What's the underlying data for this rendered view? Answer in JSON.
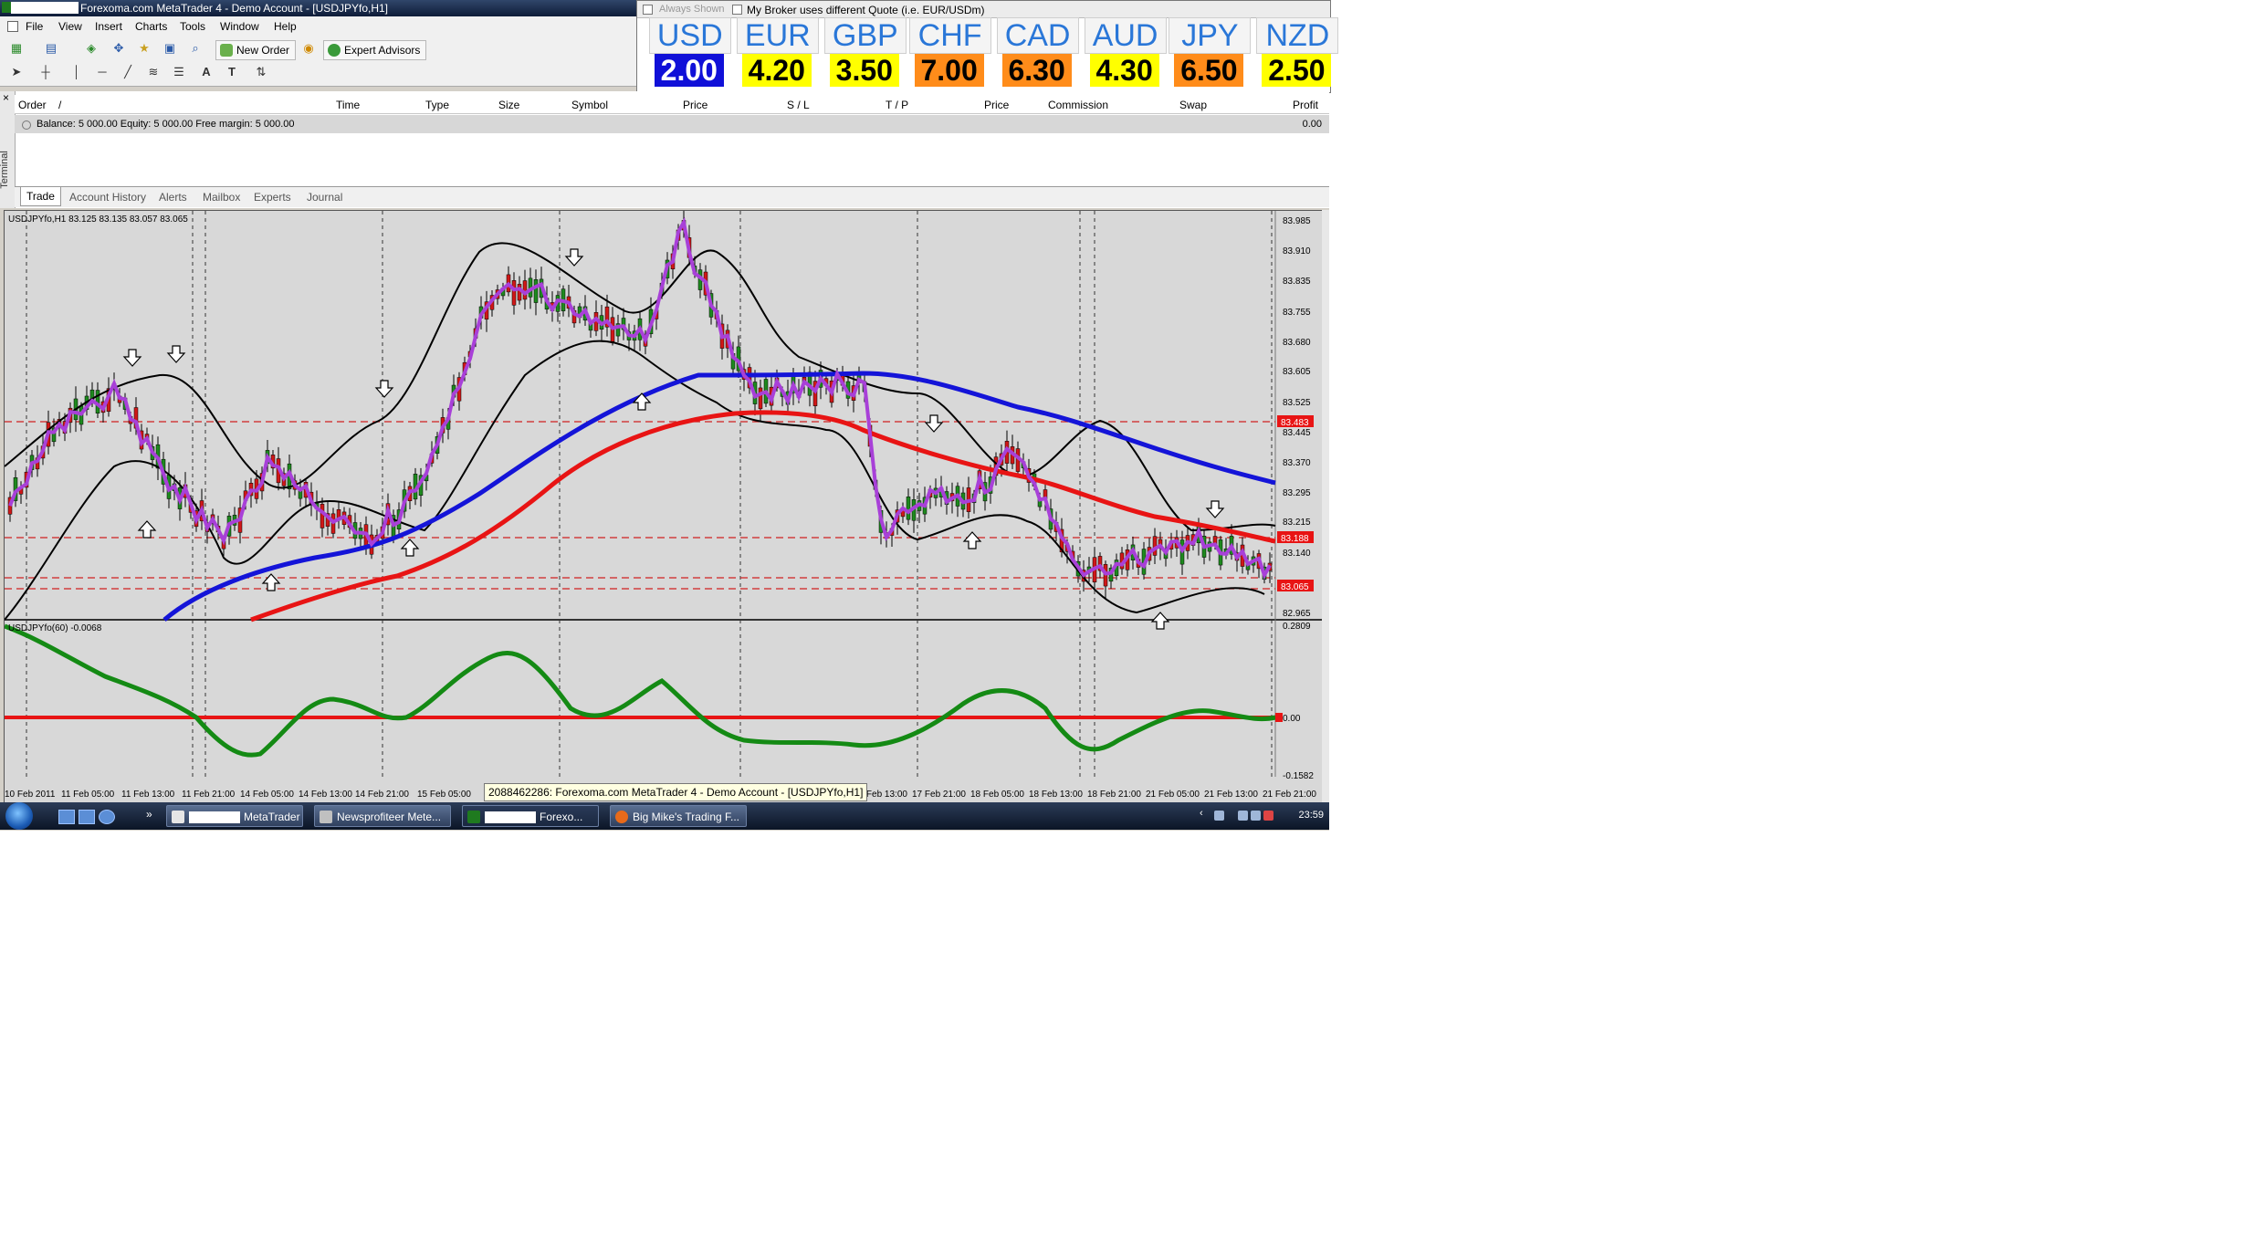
{
  "window": {
    "title": "Forexoma.com MetaTrader 4 - Demo Account - [USDJPYfo,H1]"
  },
  "menu": [
    "File",
    "View",
    "Insert",
    "Charts",
    "Tools",
    "Window",
    "Help"
  ],
  "toolbar": {
    "new_order": "New Order",
    "expert_advisors": "Expert Advisors"
  },
  "currency_widget": {
    "always_shown": "Always Shown",
    "broker_quote": "My Broker uses different Quote (i.e. EUR/USDm)",
    "items": [
      {
        "code": "USD",
        "value": "2.00",
        "bg": "#1010d8",
        "fg": "#ffffff"
      },
      {
        "code": "EUR",
        "value": "4.20",
        "bg": "#ffff00",
        "fg": "#000000"
      },
      {
        "code": "GBP",
        "value": "3.50",
        "bg": "#ffff00",
        "fg": "#000000"
      },
      {
        "code": "CHF",
        "value": "7.00",
        "bg": "#ff8c1a",
        "fg": "#000000"
      },
      {
        "code": "CAD",
        "value": "6.30",
        "bg": "#ff8c1a",
        "fg": "#000000"
      },
      {
        "code": "AUD",
        "value": "4.30",
        "bg": "#ffff00",
        "fg": "#000000"
      },
      {
        "code": "JPY",
        "value": "6.50",
        "bg": "#ff8c1a",
        "fg": "#000000"
      },
      {
        "code": "NZD",
        "value": "2.50",
        "bg": "#ffff00",
        "fg": "#000000"
      }
    ]
  },
  "terminal": {
    "side_label": "Terminal",
    "columns": [
      "Order",
      "/",
      "Time",
      "Type",
      "Size",
      "Symbol",
      "Price",
      "S / L",
      "T / P",
      "Price",
      "Commission",
      "Swap",
      "Profit"
    ],
    "balance_line": "Balance: 5 000.00   Equity: 5 000.00   Free margin: 5 000.00",
    "profit": "0.00",
    "tabs": [
      "Trade",
      "Account History",
      "Alerts",
      "Mailbox",
      "Experts",
      "Journal"
    ]
  },
  "chart": {
    "header": "USDJPYfo,H1   83.125 83.135 83.057 83.065",
    "subheader": "USDJPYfo(60)   -0.0068",
    "tooltip": "2088462286: Forexoma.com MetaTrader 4 - Demo Account - [USDJPYfo,H1]",
    "price_labels": [
      "83.985",
      "83.910",
      "83.835",
      "83.755",
      "83.680",
      "83.605",
      "83.525",
      "83.445",
      "83.370",
      "83.295",
      "83.215",
      "83.140",
      "82.965"
    ],
    "price_tags": [
      "83.483",
      "83.188",
      "83.065"
    ],
    "osc_labels": [
      "0.2809",
      "0.00",
      "-0.1582"
    ],
    "time_labels": [
      "10 Feb 2011",
      "11 Feb 05:00",
      "11 Feb 13:00",
      "11 Feb 21:00",
      "14 Feb 05:00",
      "14 Feb 13:00",
      "14 Feb 21:00",
      "15 Feb 05:00",
      "17 Feb 13:00",
      "17 Feb 21:00",
      "18 Feb 05:00",
      "18 Feb 13:00",
      "18 Feb 21:00",
      "21 Feb 05:00",
      "21 Feb 13:00",
      "21 Feb 21:00"
    ]
  },
  "taskbar": {
    "tasks": [
      "MetaTrader ...",
      "Newsprofiteer Mete...",
      "Forexo...",
      "Big Mike's Trading F..."
    ],
    "clock": "23:59"
  }
}
